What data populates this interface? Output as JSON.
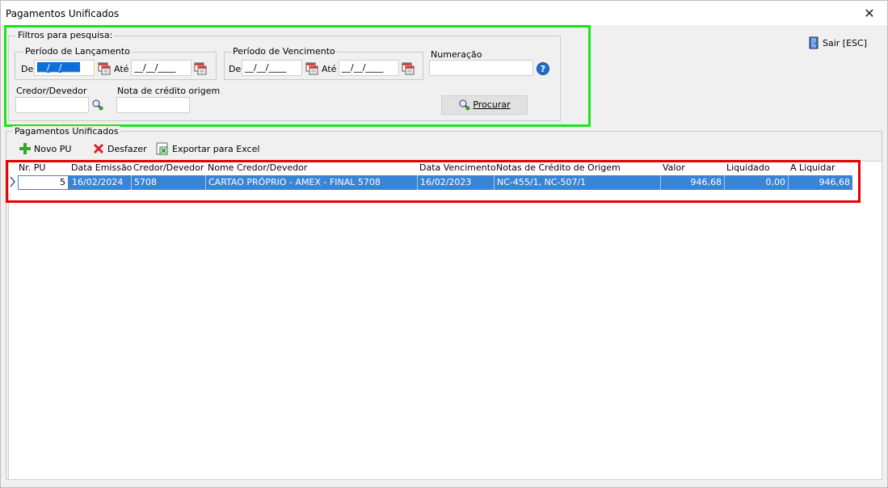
{
  "window": {
    "title": "Pagamentos Unificados",
    "close_icon": "close-icon"
  },
  "filters": {
    "legend": "Filtros para pesquisa:",
    "lancamento": {
      "legend": "Período de Lançamento",
      "de_label": "De",
      "de_value": "__/__/____",
      "ate_label": "Até",
      "ate_value": "__/__/____"
    },
    "vencimento": {
      "legend": "Período de Vencimento",
      "de_label": "De",
      "de_value": "__/__/____",
      "ate_label": "Até",
      "ate_value": "__/__/____"
    },
    "numeracao_label": "Numeração",
    "numeracao_value": "",
    "credor_label": "Credor/Devedor",
    "credor_value": "",
    "nota_label": "Nota de crédito origem",
    "nota_value": "",
    "search_button": "Procurar"
  },
  "exit_button": "Sair [ESC]",
  "pagamentos": {
    "legend": "Pagamentos Unificados",
    "toolbar": {
      "novo": "Novo PU",
      "desfazer": "Desfazer",
      "exportar": "Exportar para Excel"
    },
    "columns": [
      "Nr. PU",
      "Data Emissão",
      "Credor/Devedor",
      "Nome Credor/Devedor",
      "Data Vencimento",
      "Notas de Crédito de Origem",
      "Valor",
      "Liquidado",
      "A Liquidar"
    ],
    "rows": [
      [
        "5",
        "16/02/2024",
        "5708",
        "CARTAO PRÓPRIO - AMEX - FINAL 5708",
        "16/02/2023",
        "NC-455/1, NC-507/1",
        "946,68",
        "0,00",
        "946,68"
      ]
    ]
  },
  "colors": {
    "selection": "#3a84d6",
    "highlight_green": "#19e619",
    "highlight_red": "#e60000"
  }
}
